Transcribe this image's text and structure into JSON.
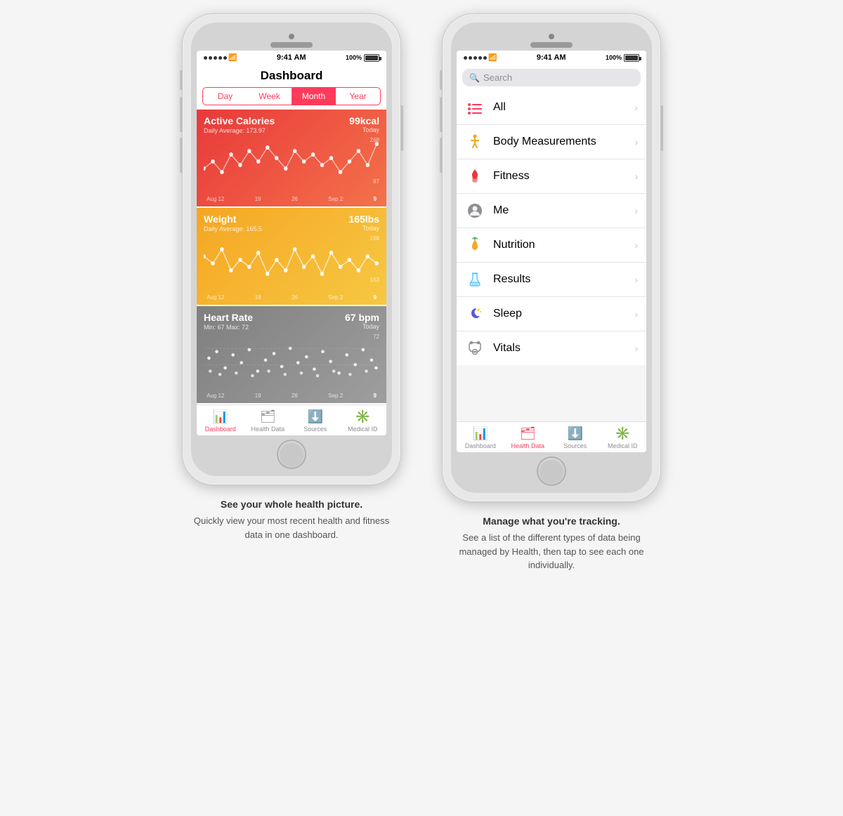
{
  "phone1": {
    "status": {
      "time": "9:41 AM",
      "battery": "100%"
    },
    "title": "Dashboard",
    "tabs": [
      "Day",
      "Week",
      "Month",
      "Year"
    ],
    "active_tab": "Month",
    "cards": [
      {
        "id": "active-calories",
        "title": "Active Calories",
        "value": "99kcal",
        "subtitle": "Daily Average: 173.97",
        "date_label": "Today",
        "y_max": "268",
        "y_min": "87",
        "dates": [
          "Aug 12",
          "19",
          "26",
          "Sep 2",
          "9"
        ],
        "type": "line",
        "color": "red"
      },
      {
        "id": "weight",
        "title": "Weight",
        "value": "165lbs",
        "subtitle": "Daily Average: 165.5",
        "date_label": "Today",
        "y_max": "168",
        "y_min": "163",
        "dates": [
          "Aug 12",
          "19",
          "26",
          "Sep 2",
          "9"
        ],
        "type": "line",
        "color": "yellow"
      },
      {
        "id": "heart-rate",
        "title": "Heart Rate",
        "value": "67 bpm",
        "subtitle": "Min: 67  Max: 72",
        "date_label": "Today",
        "y_max": "72",
        "y_min": "",
        "dates": [
          "Aug 12",
          "19",
          "26",
          "Sep 2",
          "9"
        ],
        "type": "scatter",
        "color": "gray"
      }
    ],
    "bottom_tabs": [
      {
        "label": "Dashboard",
        "active": true
      },
      {
        "label": "Health Data",
        "active": false
      },
      {
        "label": "Sources",
        "active": false
      },
      {
        "label": "Medical ID",
        "active": false
      }
    ]
  },
  "phone2": {
    "status": {
      "time": "9:41 AM",
      "battery": "100%"
    },
    "search_placeholder": "Search",
    "list_items": [
      {
        "id": "all",
        "label": "All",
        "icon_type": "all"
      },
      {
        "id": "body-measurements",
        "label": "Body Measurements",
        "icon_type": "figure"
      },
      {
        "id": "fitness",
        "label": "Fitness",
        "icon_type": "flame"
      },
      {
        "id": "me",
        "label": "Me",
        "icon_type": "person"
      },
      {
        "id": "nutrition",
        "label": "Nutrition",
        "icon_type": "carrot"
      },
      {
        "id": "results",
        "label": "Results",
        "icon_type": "flask"
      },
      {
        "id": "sleep",
        "label": "Sleep",
        "icon_type": "moon"
      },
      {
        "id": "vitals",
        "label": "Vitals",
        "icon_type": "stethoscope"
      }
    ],
    "bottom_tabs": [
      {
        "label": "Dashboard",
        "active": false
      },
      {
        "label": "Health Data",
        "active": true
      },
      {
        "label": "Sources",
        "active": false
      },
      {
        "label": "Medical ID",
        "active": false
      }
    ]
  },
  "captions": [
    {
      "headline": "See your whole health picture.",
      "body": "Quickly view your most recent health and fitness data in one dashboard."
    },
    {
      "headline": "Manage what you're tracking.",
      "body": "See a list of the different types of data being managed by Health, then tap to see each one individually."
    }
  ]
}
